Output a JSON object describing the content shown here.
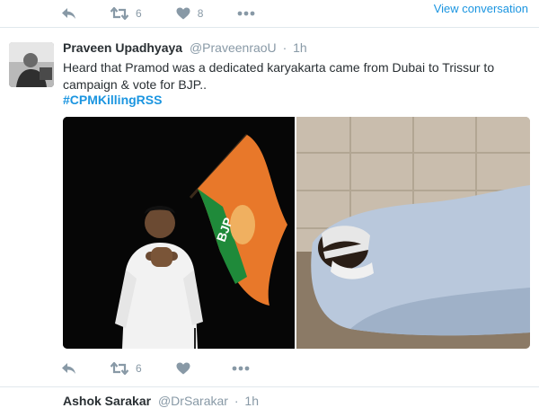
{
  "top_bar": {
    "retweet_count": "6",
    "like_count": "8",
    "view_conversation": "View conversation"
  },
  "tweet": {
    "author_name": "Praveen Upadhyaya",
    "handle": "@PraveenraoU",
    "separator": "·",
    "time": "1h",
    "text": "Heard that Pramod was a dedicated karyakarta came from Dubai to Trissur to campaign & vote for BJP..",
    "hashtag": "#CPMKillingRSS",
    "retweet_count": "6",
    "like_count": ""
  },
  "next_tweet": {
    "author_name": "Ashok Sarakar",
    "handle": "@DrSarakar",
    "separator": "·",
    "time": "1h"
  },
  "colors": {
    "link_blue": "#1b95e0",
    "muted_gray": "#8899a6",
    "text": "#292f33",
    "divider": "#e1e8ed"
  }
}
